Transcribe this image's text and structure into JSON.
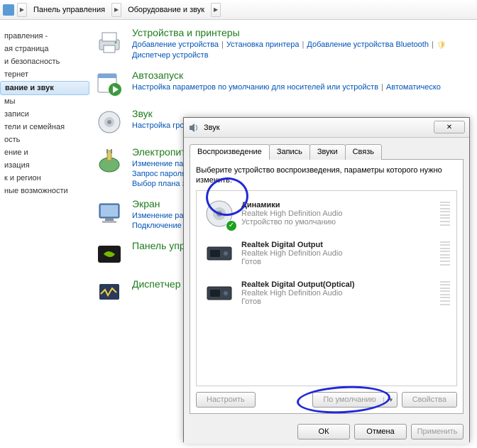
{
  "breadcrumb": {
    "seg1": "Панель управления",
    "seg2": "Оборудование и звук"
  },
  "sidebar": {
    "items": [
      "",
      "правления -",
      "ая страница",
      "и безопасность",
      "тернет",
      "вание и звук",
      "мы",
      "записи",
      "тели и семейная",
      "ость",
      "ение и",
      "изация",
      "к и регион",
      "ные возможности"
    ],
    "selectedIndex": 5
  },
  "cats": {
    "devices": {
      "title": "Устройства и принтеры",
      "links": [
        "Добавление устройства",
        "Установка принтера",
        "Добавление устройства Bluetooth",
        "Диспетчер устройств"
      ]
    },
    "autoplay": {
      "title": "Автозапуск",
      "links": [
        "Настройка параметров по умолчанию для носителей или устройств",
        "Автоматическо"
      ]
    },
    "sound": {
      "title": "Звук",
      "links": [
        "Настройка гро"
      ]
    },
    "power": {
      "title": "Электропит",
      "links": [
        "Изменение пар",
        "Запрос пароля",
        "Выбор плана з"
      ]
    },
    "screen": {
      "title": "Экран",
      "links": [
        "Изменение раз",
        "Подключение"
      ]
    },
    "nvidia": {
      "title": "Панель упр"
    },
    "task": {
      "title": "Диспетчер"
    }
  },
  "dlg": {
    "title": "Звук",
    "tabs": [
      "Воспроизведение",
      "Запись",
      "Звуки",
      "Связь"
    ],
    "activeTab": 0,
    "hint": "Выберите устройство воспроизведения, параметры которого нужно изменить:",
    "devices": [
      {
        "name": "Динамики",
        "sub1": "Realtek High Definition Audio",
        "sub2": "Устройство по умолчанию",
        "default": true,
        "type": "speaker"
      },
      {
        "name": "Realtek Digital Output",
        "sub1": "Realtek High Definition Audio",
        "sub2": "Готов",
        "default": false,
        "type": "digital"
      },
      {
        "name": "Realtek Digital Output(Optical)",
        "sub1": "Realtek High Definition Audio",
        "sub2": "Готов",
        "default": false,
        "type": "digital"
      }
    ],
    "btnConfigure": "Настроить",
    "btnDefault": "По умолчанию",
    "btnProps": "Свойства",
    "btnOk": "ОК",
    "btnCancel": "Отмена",
    "btnApply": "Применить"
  }
}
